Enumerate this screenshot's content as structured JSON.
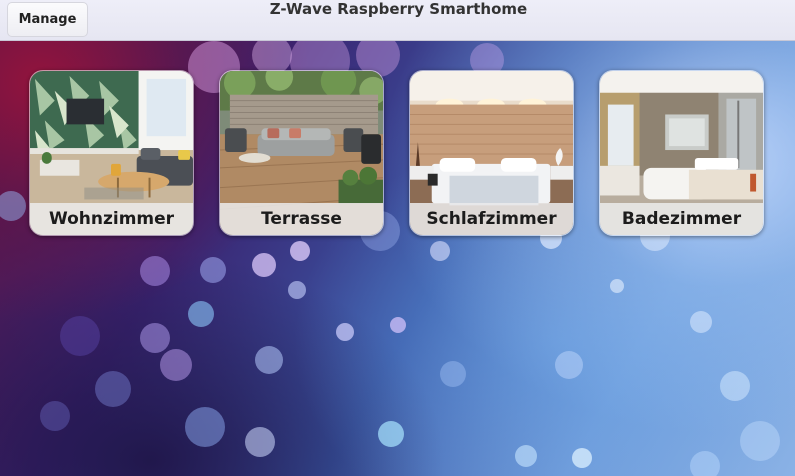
{
  "header": {
    "manage_label": "Manage",
    "title": "Z-Wave Raspberry Smarthome"
  },
  "rooms": [
    {
      "label": "Wohnzimmer",
      "icon": "living-room-photo"
    },
    {
      "label": "Terrasse",
      "icon": "terrace-photo"
    },
    {
      "label": "Schlafzimmer",
      "icon": "bedroom-photo"
    },
    {
      "label": "Badezimmer",
      "icon": "bathroom-photo"
    }
  ],
  "colors": {
    "header_bg": "#e6e6f2",
    "label_bg": "#ebebeb",
    "text": "#1c1c1c"
  }
}
